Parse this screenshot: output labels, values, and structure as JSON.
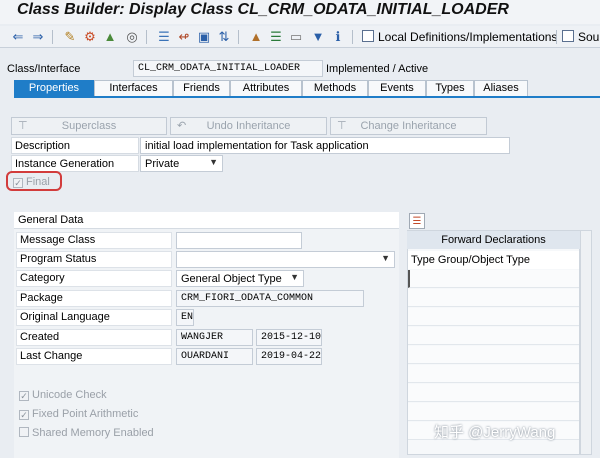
{
  "window": {
    "title": "Class Builder: Display Class CL_CRM_ODATA_INITIAL_LOADER"
  },
  "toolbar": {
    "icons": [
      "back-icon",
      "forward-icon",
      "other-object-icon",
      "display-change-icon",
      "activate-icon",
      "where-used-icon",
      "object-list-icon",
      "hierarchy-icon",
      "edit-icon",
      "tree-icon",
      "move-icon",
      "expand-icon",
      "collapse-icon",
      "window-icon",
      "filter-icon",
      "info-icon"
    ],
    "local_definitions_label": "Local Definitions/Implementations",
    "source_label": "Sour"
  },
  "header": {
    "class_label": "Class/Interface",
    "class_value": "CL_CRM_ODATA_INITIAL_LOADER",
    "status": "Implemented / Active"
  },
  "tabs": [
    {
      "label": "Properties",
      "active": true
    },
    {
      "label": "Interfaces"
    },
    {
      "label": "Friends"
    },
    {
      "label": "Attributes"
    },
    {
      "label": "Methods"
    },
    {
      "label": "Events"
    },
    {
      "label": "Types"
    },
    {
      "label": "Aliases"
    }
  ],
  "inheritance_buttons": {
    "superclass": "Superclass",
    "undo": "Undo Inheritance",
    "change": "Change Inheritance"
  },
  "properties": {
    "description_label": "Description",
    "description_value": "initial load implementation for Task application",
    "instance_generation_label": "Instance Generation",
    "instance_generation_value": "Private",
    "final_label": "Final"
  },
  "general_data": {
    "title": "General Data",
    "message_class_label": "Message Class",
    "program_status_label": "Program Status",
    "category_label": "Category",
    "category_value": "General Object Type",
    "package_label": "Package",
    "package_value": "CRM_FIORI_ODATA_COMMON",
    "original_language_label": "Original Language",
    "original_language_value": "EN",
    "created_label": "Created",
    "created_by": "WANGJER",
    "created_on": "2015-12-10",
    "last_change_label": "Last Change",
    "last_change_by": "OUARDANI",
    "last_change_on": "2019-04-22",
    "unicode_check_label": "Unicode Check",
    "fixed_point_label": "Fixed Point Arithmetic",
    "shared_memory_label": "Shared Memory Enabled"
  },
  "forward_declarations": {
    "title": "Forward Declarations",
    "column": "Type Group/Object Type"
  },
  "watermark": "知乎 @JerryWang"
}
